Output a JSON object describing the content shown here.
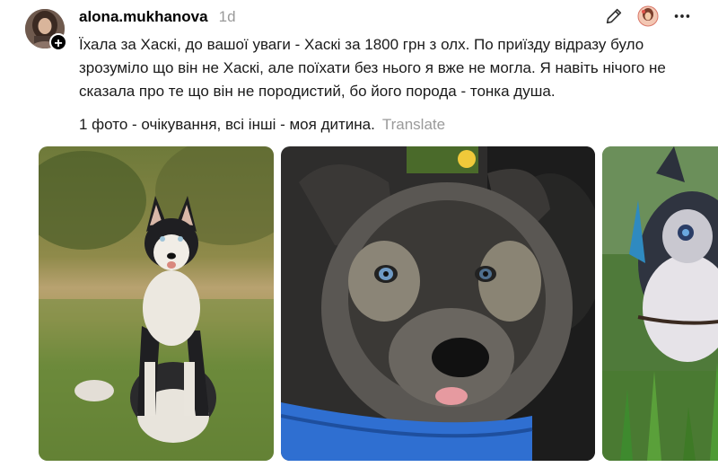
{
  "post": {
    "author": "alona.mukhanova",
    "time": "1d",
    "caption": "Їхала за Хаскі, до вашої уваги - Хаскі за 1800 грн з олх. По приїзду відразу було зрозуміло що він не Хаскі, але поїхати без нього я вже не могла. Я навіть нічого не сказала про те що він не породистий, бо його порода - тонка душа.",
    "caption_line2": "1 фото - очікування, всі інші - моя дитина.",
    "translate_label": "Translate",
    "follow_symbol": "+"
  },
  "icons": {
    "edit": "pencil-icon",
    "reaction": "avatar-reaction-icon",
    "more": "more-options-icon"
  },
  "photos": [
    {
      "alt": "husky-expectation-photo"
    },
    {
      "alt": "puppy-closeup-photo"
    },
    {
      "alt": "puppy-grass-photo"
    }
  ]
}
